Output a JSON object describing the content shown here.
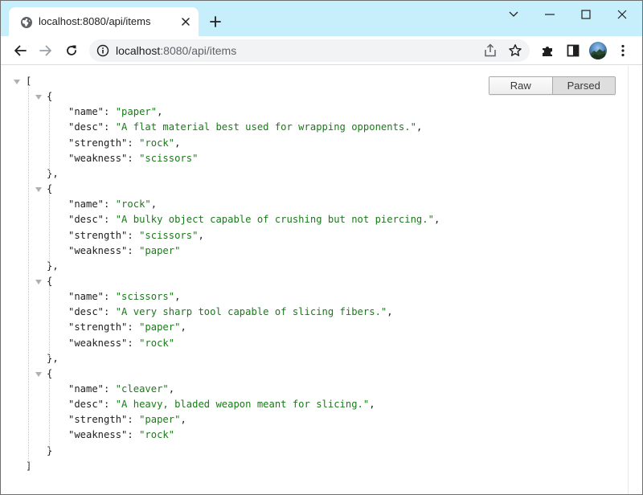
{
  "window": {
    "controls": [
      "chevron-down-icon",
      "minimize-icon",
      "maximize-icon",
      "close-icon"
    ]
  },
  "tab": {
    "title": "localhost:8080/api/items",
    "favicon": "globe-icon"
  },
  "toolbar": {
    "url_host": "localhost",
    "url_rest": ":8080/api/items",
    "icons": [
      "back-icon",
      "forward-icon",
      "reload-icon",
      "info-icon",
      "share-icon",
      "star-icon",
      "extensions-icon",
      "side-panel-icon",
      "avatar",
      "menu-icon"
    ]
  },
  "viewer": {
    "raw_label": "Raw",
    "parsed_label": "Parsed",
    "selected": "Parsed"
  },
  "json": {
    "items": [
      {
        "name": "paper",
        "desc": "A flat material best used for wrapping opponents.",
        "strength": "rock",
        "weakness": "scissors"
      },
      {
        "name": "rock",
        "desc": "A bulky object capable of crushing but not piercing.",
        "strength": "scissors",
        "weakness": "paper"
      },
      {
        "name": "scissors",
        "desc": "A very sharp tool capable of slicing fibers.",
        "strength": "paper",
        "weakness": "rock"
      },
      {
        "name": "cleaver",
        "desc": "A heavy, bladed weapon meant for slicing.",
        "strength": "paper",
        "weakness": "rock"
      }
    ]
  },
  "colors": {
    "tabstrip": "#c7eefb",
    "string_value": "#1a7a1a",
    "omnibox": "#f1f3f4"
  }
}
